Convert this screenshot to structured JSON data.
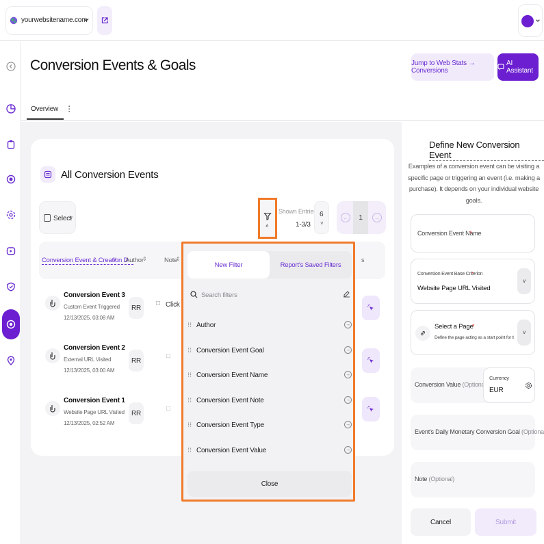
{
  "topbar": {
    "domain": "yourwebsitename.com"
  },
  "header": {
    "title": "Conversion Events & Goals",
    "jump_button": "Jump to Web Stats → Conversions",
    "ai_button": "AI Assistant",
    "tab": "Overview"
  },
  "card": {
    "title": "All Conversion Events",
    "select_label": "Select",
    "shown_entries_label": "Shown Entries",
    "shown_entries_range": "1-3/3",
    "page_size": "6",
    "page_number": "1",
    "columns": {
      "event": "Conversion Event & Creation D...",
      "author": "Author",
      "note": "Note"
    },
    "rows": [
      {
        "name": "Conversion Event 3",
        "type": "Custom Event Triggered",
        "date": "12/13/2025, 03:08 AM",
        "author": "RR",
        "note": "Click o"
      },
      {
        "name": "Conversion Event 2",
        "type": "External URL Visited",
        "date": "12/13/2025, 03:00 AM",
        "author": "RR",
        "note": ""
      },
      {
        "name": "Conversion Event 1",
        "type": "Website Page URL Visited",
        "date": "12/13/2025, 02:52 AM",
        "author": "RR",
        "note": ""
      }
    ]
  },
  "filter_panel": {
    "tab_new": "New Filter",
    "tab_saved": "Report's Saved Filters",
    "search_placeholder": "Search filters",
    "items": [
      "Author",
      "Conversion Event Goal",
      "Conversion Event Name",
      "Conversion Event Note",
      "Conversion Event Type",
      "Conversion Event Value"
    ],
    "close": "Close"
  },
  "right_panel": {
    "title": "Define New Conversion Event",
    "description": "Examples of a conversion event can be visiting a specific page or triggering an event (i.e. making a purchase). It depends on your individual website goals.",
    "name_label": "Conversion Event Name",
    "required": "*",
    "criterion_label": "Conversion Event Base Criterion",
    "criterion_value": "Website Page URL Visited",
    "page_label": "Select a Page",
    "page_desc": "Define the page acting as a start point for th...",
    "value_label": "Conversion Value",
    "optional": "(Optional)",
    "currency_label": "Currency",
    "currency_value": "EUR",
    "goal_label": "Event's Daily Monetary Conversion Goal",
    "note_label": "Note",
    "cancel": "Cancel",
    "submit": "Submit"
  },
  "colors": {
    "accent": "#6b1fd0",
    "highlight": "#f07a2a"
  }
}
